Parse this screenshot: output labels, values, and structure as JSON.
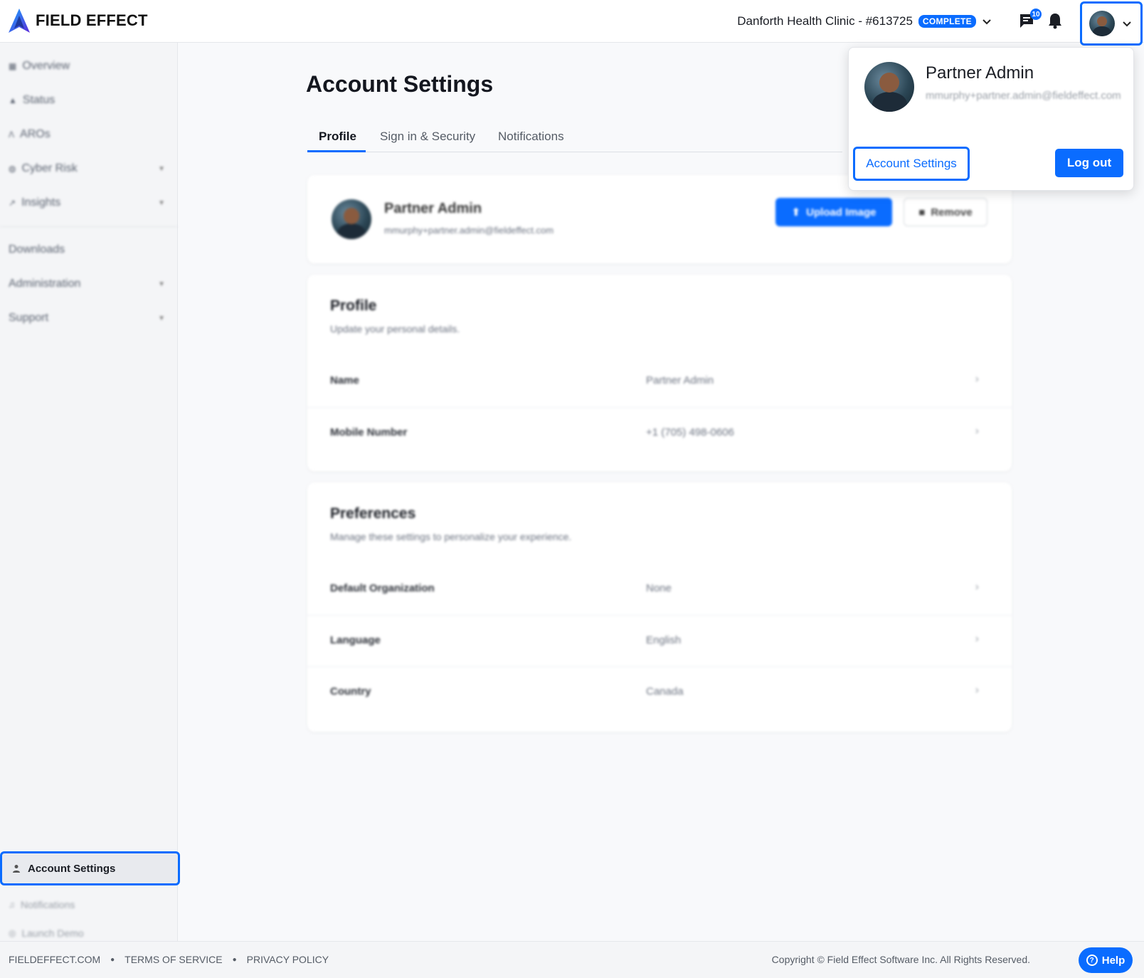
{
  "header": {
    "logo_text": "FIELD EFFECT",
    "org_name": "Danforth Health Clinic - #613725",
    "org_status": "COMPLETE",
    "message_count": "10",
    "icons": [
      "chat-icon",
      "bell-icon",
      "chevron-down-icon"
    ]
  },
  "sidebar": {
    "items": [
      {
        "label": "Overview",
        "icon": "grid-icon"
      },
      {
        "label": "Status",
        "icon": "pulse-icon"
      },
      {
        "label": "AROs",
        "icon": "aro-icon"
      },
      {
        "label": "Cyber Risk",
        "icon": "globe-icon"
      },
      {
        "label": "Insights",
        "icon": "trend-icon"
      },
      {
        "label": "Downloads"
      },
      {
        "label": "Administration"
      },
      {
        "label": "Support"
      }
    ],
    "bottom": {
      "active": "Account Settings",
      "notifications": "Notifications",
      "launch_demo": "Launch Demo"
    }
  },
  "main": {
    "title": "Account Settings",
    "tabs": [
      "Profile",
      "Sign in & Security",
      "Notifications"
    ],
    "profile_card": {
      "name": "Partner Admin",
      "email": "mmurphy+partner.admin@fieldeffect.com",
      "upload_label": "Upload Image",
      "remove_label": "Remove"
    },
    "profile_section": {
      "title": "Profile",
      "subtitle": "Update your personal details.",
      "rows": [
        {
          "label": "Name",
          "value": "Partner Admin"
        },
        {
          "label": "Mobile Number",
          "value": "+1 (705) 498-0606"
        }
      ]
    },
    "preferences_section": {
      "title": "Preferences",
      "subtitle": "Manage these settings to personalize your experience.",
      "rows": [
        {
          "label": "Default Organization",
          "value": "None"
        },
        {
          "label": "Language",
          "value": "English"
        },
        {
          "label": "Country",
          "value": "Canada"
        }
      ]
    }
  },
  "dropdown": {
    "name": "Partner Admin",
    "email": "mmurphy+partner.admin@fieldeffect.com",
    "account_settings": "Account Settings",
    "logout": "Log out"
  },
  "footer": {
    "links": [
      "FIELDEFFECT.COM",
      "TERMS OF SERVICE",
      "PRIVACY POLICY"
    ],
    "copyright": "Copyright © Field Effect Software Inc. All Rights Reserved.",
    "help": "Help"
  },
  "colors": {
    "accent": "#0a6cff",
    "background": "#f8f9fb"
  }
}
